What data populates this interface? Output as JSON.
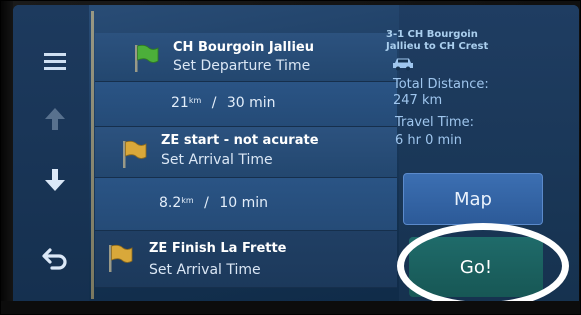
{
  "route": {
    "waypoints": [
      {
        "name": "CH Bourgoin Jallieu",
        "action": "Set Departure Time",
        "flag": "green-flag-icon"
      },
      {
        "name": "ZE start - not acurate",
        "action": "Set Arrival Time",
        "flag": "yellow-flag-icon"
      },
      {
        "name": "ZE Finish La Frette",
        "action": "Set Arrival Time",
        "flag": "yellow-flag-icon"
      }
    ],
    "legs": [
      {
        "distance": "21",
        "distance_unit": "km",
        "time": "30 min"
      },
      {
        "distance": "8.2",
        "distance_unit": "km",
        "time": "10 min"
      }
    ],
    "separator": "/"
  },
  "info": {
    "route_title_line1": "3-1 CH Bourgoin",
    "route_title_line2": "Jallieu to CH Crest",
    "vehicle_icon": "car-icon",
    "total_distance_label": "Total Distance:",
    "total_distance_value": "247 km",
    "travel_time_label": "Travel Time:",
    "travel_time_value": "6 hr 0 min"
  },
  "buttons": {
    "map_label": "Map",
    "go_label": "Go!"
  },
  "side_rail": {
    "menu_icon": "menu-icon",
    "up_icon": "arrow-up-icon",
    "down_icon": "arrow-down-icon",
    "back_icon": "back-icon"
  },
  "colors": {
    "screen_blue": "#1d3d62",
    "title_text": "#ffffff",
    "info_text": "#9fc6ee",
    "go_button": "#1f6b6a",
    "map_button": "#3c6fb2",
    "flag_green": "#4caf3a",
    "flag_yellow": "#d9a83a"
  }
}
